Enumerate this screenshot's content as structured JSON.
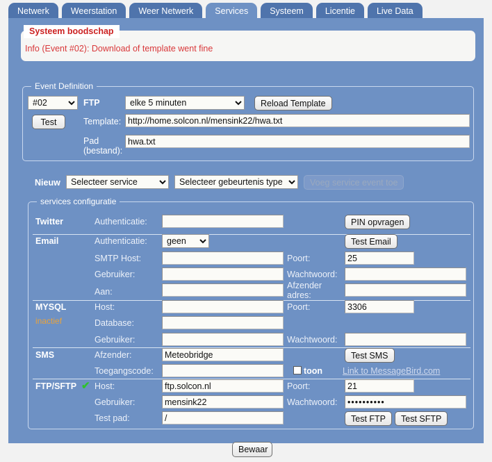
{
  "tabs": [
    {
      "label": "Netwerk",
      "active": false
    },
    {
      "label": "Weerstation",
      "active": false
    },
    {
      "label": "Weer Netwerk",
      "active": false
    },
    {
      "label": "Services",
      "active": true
    },
    {
      "label": "Systeem",
      "active": false
    },
    {
      "label": "Licentie",
      "active": false
    },
    {
      "label": "Live Data",
      "active": false
    }
  ],
  "system_message": {
    "legend": "Systeem boodschap",
    "text": "Info (Event #02): Download of template went fine"
  },
  "event_definition": {
    "legend": "Event Definition",
    "event_number": "#02",
    "service_type": "FTP",
    "interval": "elke 5 minuten",
    "reload_button": "Reload Template",
    "test_button": "Test",
    "template_label": "Template:",
    "template_value": "http://home.solcon.nl/mensink22/hwa.txt",
    "path_label_line1": "Pad",
    "path_label_line2": "(bestand):",
    "path_value": "hwa.txt"
  },
  "new_row": {
    "label": "Nieuw",
    "service_select": "Selecteer service",
    "event_type_select": "Selecteer gebeurtenis type",
    "add_button": "Voeg service event toe"
  },
  "services": {
    "legend": "services configuratie",
    "twitter": {
      "name": "Twitter",
      "auth_label": "Authenticatie:",
      "auth_value": "",
      "pin_button": "PIN opvragen"
    },
    "email": {
      "name": "Email",
      "auth_label": "Authenticatie:",
      "auth_value": "geen",
      "test_button": "Test Email",
      "smtp_label": "SMTP Host:",
      "smtp_value": "",
      "port_label": "Poort:",
      "port_value": "25",
      "user_label": "Gebruiker:",
      "user_value": "",
      "password_label": "Wachtwoord:",
      "password_value": "",
      "to_label": "Aan:",
      "to_value": "",
      "sender_label_line1": "Afzender",
      "sender_label_line2": "adres:",
      "sender_value": ""
    },
    "mysql": {
      "name": "MYSQL",
      "status": "inactief",
      "host_label": "Host:",
      "host_value": "",
      "port_label": "Poort:",
      "port_value": "3306",
      "database_label": "Database:",
      "database_value": "",
      "user_label": "Gebruiker:",
      "user_value": "",
      "password_label": "Wachtwoord:",
      "password_value": ""
    },
    "sms": {
      "name": "SMS",
      "sender_label": "Afzender:",
      "sender_value": "Meteobridge",
      "test_button": "Test SMS",
      "accesscode_label": "Toegangscode:",
      "accesscode_value": "",
      "show_label": "toon",
      "link_text": "Link to MessageBird.com"
    },
    "ftp": {
      "name": "FTP/SFTP",
      "status_icon": "check-icon",
      "host_label": "Host:",
      "host_value": "ftp.solcon.nl",
      "port_label": "Poort:",
      "port_value": "21",
      "user_label": "Gebruiker:",
      "user_value": "mensink22",
      "password_label": "Wachtwoord:",
      "password_value": "••••••••••",
      "testpath_label": "Test pad:",
      "testpath_value": "/",
      "test_ftp_button": "Test FTP",
      "test_sftp_button": "Test SFTP"
    }
  },
  "footer": {
    "save_button": "Bewaar"
  },
  "colors": {
    "panel_bg": "#6e91c4",
    "tab_inactive": "#4f74ac",
    "tab_active": "#6e91c4",
    "error_text": "#d9383a",
    "inactive_status": "#e8a33d",
    "check_green": "#2fc22f",
    "link": "#cfd9ee"
  }
}
